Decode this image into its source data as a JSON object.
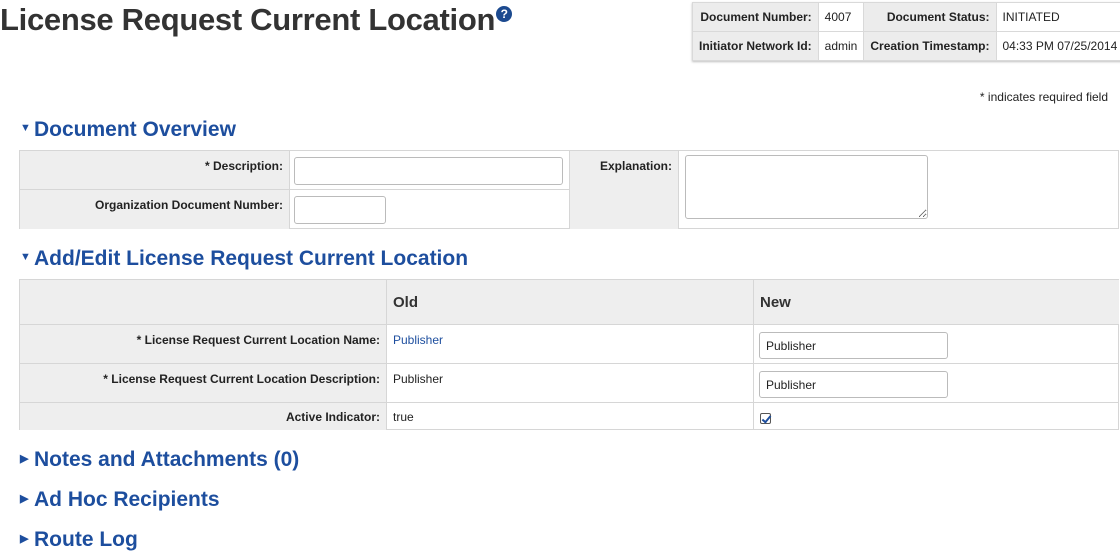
{
  "page": {
    "title": "License Request Current Location",
    "help_glyph": "?",
    "required_note": "* indicates required field"
  },
  "doc_header": {
    "doc_number_label": "Document Number:",
    "doc_number": "4007",
    "doc_status_label": "Document Status:",
    "doc_status": "INITIATED",
    "initiator_label": "Initiator Network Id:",
    "initiator": "admin",
    "created_label": "Creation Timestamp:",
    "created": "04:33 PM 07/25/2014"
  },
  "overview": {
    "header": "Document Overview",
    "description_label": "* Description:",
    "description_value": "",
    "org_doc_number_label": "Organization Document Number:",
    "org_doc_number_value": "",
    "explanation_label": "Explanation:",
    "explanation_value": ""
  },
  "edit": {
    "header": "Add/Edit License Request Current Location",
    "col_old": "Old",
    "col_new": "New",
    "rows": [
      {
        "label": "* License Request Current Location Name:",
        "old": "Publisher",
        "new": "Publisher"
      },
      {
        "label": "* License Request Current Location Description:",
        "old": "Publisher",
        "new": "Publisher"
      },
      {
        "label": "Active Indicator:",
        "old": "true",
        "new_checked": true
      }
    ]
  },
  "collapsed_sections": [
    {
      "label": "Notes and Attachments (0)"
    },
    {
      "label": "Ad Hoc Recipients"
    },
    {
      "label": "Route Log"
    }
  ],
  "icons": {
    "expanded": "caret-down-icon",
    "collapsed": "caret-right-icon",
    "help": "help-icon",
    "checkbox": "checkbox-checked-icon"
  },
  "colors": {
    "section_blue": "#1d4e9e",
    "label_gray": "#eeeeee",
    "border": "#d6d6d6"
  }
}
